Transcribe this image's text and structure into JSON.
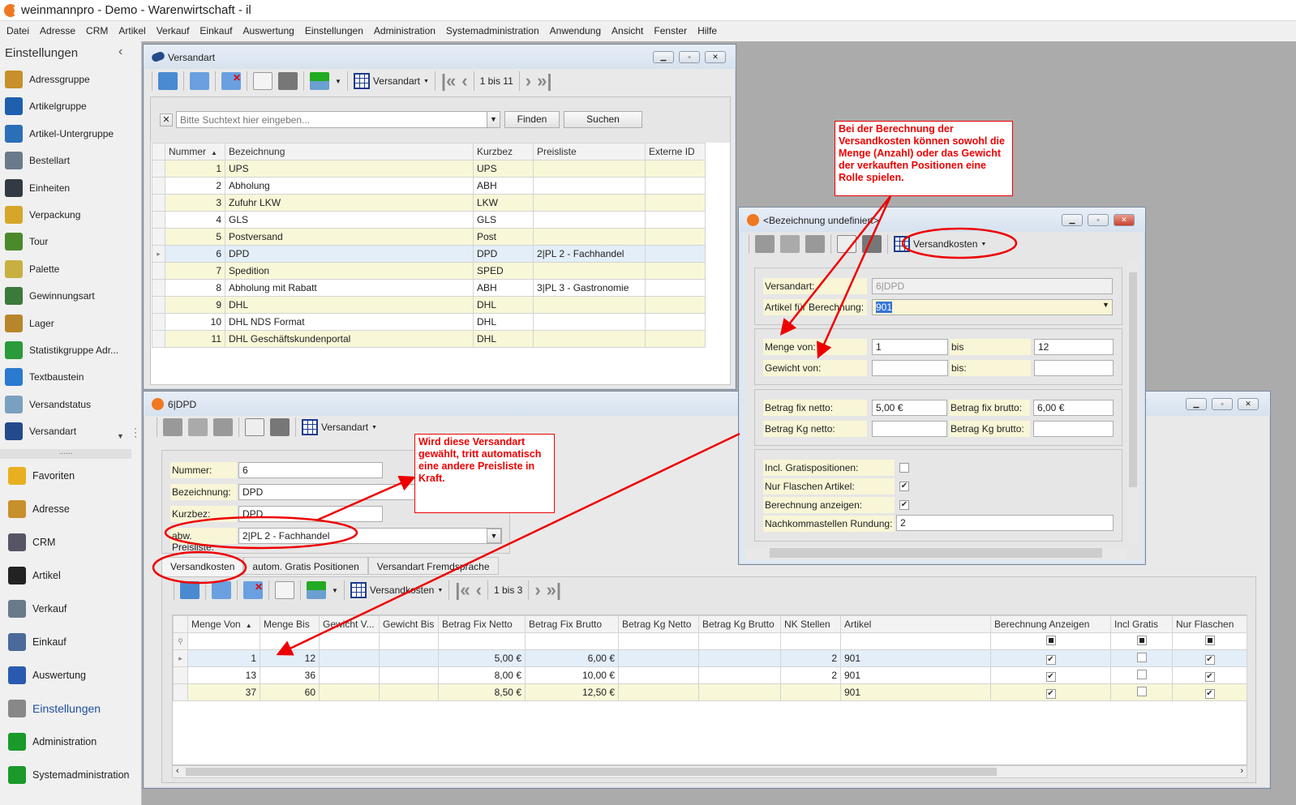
{
  "app": {
    "title": "weinmannpro - Demo - Warenwirtschaft - il"
  },
  "menu": [
    "Datei",
    "Adresse",
    "CRM",
    "Artikel",
    "Verkauf",
    "Einkauf",
    "Auswertung",
    "Einstellungen",
    "Administration",
    "Systemadministration",
    "Anwendung",
    "Ansicht",
    "Fenster",
    "Hilfe"
  ],
  "sidebar": {
    "title": "Einstellungen",
    "more_label": "......",
    "items": [
      {
        "label": "Adressgruppe",
        "color": "#c8902a"
      },
      {
        "label": "Artikelgruppe",
        "color": "#1f5fae"
      },
      {
        "label": "Artikel-Untergruppe",
        "color": "#2a6fb8"
      },
      {
        "label": "Bestellart",
        "color": "#6a7a8a"
      },
      {
        "label": "Einheiten",
        "color": "#333a44"
      },
      {
        "label": "Verpackung",
        "color": "#d6a62a"
      },
      {
        "label": "Tour",
        "color": "#4a8a2a"
      },
      {
        "label": "Palette",
        "color": "#c8b040"
      },
      {
        "label": "Gewinnungsart",
        "color": "#3a7a3a"
      },
      {
        "label": "Lager",
        "color": "#b8862a"
      },
      {
        "label": "Statistikgruppe Adr...",
        "color": "#2a9a3a"
      },
      {
        "label": "Textbaustein",
        "color": "#2a7ad0"
      },
      {
        "label": "Versandstatus",
        "color": "#7aa0c0"
      },
      {
        "label": "Versandart",
        "color": "#234a8a"
      }
    ],
    "nav": [
      {
        "label": "Favoriten",
        "color": "#e8b020"
      },
      {
        "label": "Adresse",
        "color": "#c8902a"
      },
      {
        "label": "CRM",
        "color": "#556"
      },
      {
        "label": "Artikel",
        "color": "#222"
      },
      {
        "label": "Verkauf",
        "color": "#6a7a8a"
      },
      {
        "label": "Einkauf",
        "color": "#4a6a9a"
      },
      {
        "label": "Auswertung",
        "color": "#2a5ab0"
      },
      {
        "label": "Einstellungen",
        "color": "#888"
      },
      {
        "label": "Administration",
        "color": "#1a9a2a"
      },
      {
        "label": "Systemadministration",
        "color": "#1a9a2a"
      }
    ]
  },
  "list_window": {
    "title": "Versandart",
    "view_label": "Versandart",
    "pager": "1 bis 11",
    "search": {
      "placeholder": "Bitte Suchtext hier eingeben...",
      "find": "Finden",
      "search": "Suchen"
    },
    "columns": [
      "Nummer",
      "Bezeichnung",
      "Kurzbez",
      "Preisliste",
      "Externe ID"
    ],
    "rows": [
      [
        "1",
        "UPS",
        "UPS",
        "",
        ""
      ],
      [
        "2",
        "Abholung",
        "ABH",
        "",
        ""
      ],
      [
        "3",
        "Zufuhr LKW",
        "LKW",
        "",
        ""
      ],
      [
        "4",
        "GLS",
        "GLS",
        "",
        ""
      ],
      [
        "5",
        "Postversand",
        "Post",
        "",
        ""
      ],
      [
        "6",
        "DPD",
        "DPD",
        "2|PL 2 - Fachhandel",
        ""
      ],
      [
        "7",
        "Spedition",
        "SPED",
        "",
        ""
      ],
      [
        "8",
        "Abholung mit Rabatt",
        "ABH",
        "3|PL 3 - Gastronomie",
        ""
      ],
      [
        "9",
        "DHL",
        "DHL",
        "",
        ""
      ],
      [
        "10",
        "DHL NDS Format",
        "DHL",
        "",
        ""
      ],
      [
        "11",
        "DHL Geschäftskundenportal",
        "DHL",
        "",
        ""
      ]
    ],
    "selected_row": 6
  },
  "detail_window": {
    "title": "6|DPD",
    "view_label": "Versandart",
    "fields": {
      "nummer_label": "Nummer:",
      "nummer": "6",
      "bezeichnung_label": "Bezeichnung:",
      "bezeichnung": "DPD",
      "kurzbez_label": "Kurzbez:",
      "kurzbez": "DPD",
      "preisliste_label": "abw. Preisliste:",
      "preisliste": "2|PL 2 - Fachhandel"
    },
    "tabs": [
      "Versandkosten",
      "autom. Gratis Positionen",
      "Versandart Fremdsprache"
    ],
    "sub_view_label": "Versandkosten",
    "sub_pager": "1 bis 3",
    "columns": [
      "Menge Von",
      "Menge Bis",
      "Gewicht V...",
      "Gewicht Bis",
      "Betrag Fix Netto",
      "Betrag Fix Brutto",
      "Betrag Kg Netto",
      "Betrag Kg Brutto",
      "NK Stellen",
      "Artikel",
      "Berechnung Anzeigen",
      "Incl Gratis",
      "Nur Flaschen"
    ],
    "rows": [
      {
        "cells": [
          "1",
          "12",
          "",
          "",
          "5,00 €",
          "6,00 €",
          "",
          "",
          "2",
          "901"
        ],
        "berechnung": true,
        "gratis": false,
        "flaschen": true
      },
      {
        "cells": [
          "13",
          "36",
          "",
          "",
          "8,00 €",
          "10,00 €",
          "",
          "",
          "2",
          "901"
        ],
        "berechnung": true,
        "gratis": false,
        "flaschen": true
      },
      {
        "cells": [
          "37",
          "60",
          "",
          "",
          "8,50 €",
          "12,50 €",
          "",
          "",
          "",
          "901"
        ],
        "berechnung": true,
        "gratis": false,
        "flaschen": true
      }
    ]
  },
  "dialog": {
    "title": "<Bezeichnung undefiniert>",
    "view_label": "Versandkosten",
    "versandart_label": "Versandart:",
    "versandart": "6|DPD",
    "artikel_label": "Artikel für Berechnung:",
    "artikel": "901",
    "menge_von_label": "Menge von:",
    "menge_von": "1",
    "bis_label": "bis",
    "menge_bis": "12",
    "gewicht_von_label": "Gewicht von:",
    "gewicht_von": "",
    "gewicht_bis_label": "bis:",
    "gewicht_bis": "",
    "fix_netto_label": "Betrag fix netto:",
    "fix_netto": "5,00 €",
    "fix_brutto_label": "Betrag fix brutto:",
    "fix_brutto": "6,00 €",
    "kg_netto_label": "Betrag Kg netto:",
    "kg_netto": "",
    "kg_brutto_label": "Betrag Kg brutto:",
    "kg_brutto": "",
    "gratis_label": "Incl. Gratispositionen:",
    "gratis": false,
    "flaschen_label": "Nur Flaschen Artikel:",
    "flaschen": true,
    "anzeigen_label": "Berechnung anzeigen:",
    "anzeigen": true,
    "rundung_label": "Nachkommastellen Rundung:",
    "rundung": "2"
  },
  "annotations": {
    "note1": "Bei der Berechnung der Versandkosten können sowohl die Menge (Anzahl) oder das Gewicht der verkauften Positionen eine Rolle spielen.",
    "note2": "Wird diese Versandart gewählt, tritt automatisch eine andere Preisliste in Kraft.",
    "color": "#e00000"
  }
}
